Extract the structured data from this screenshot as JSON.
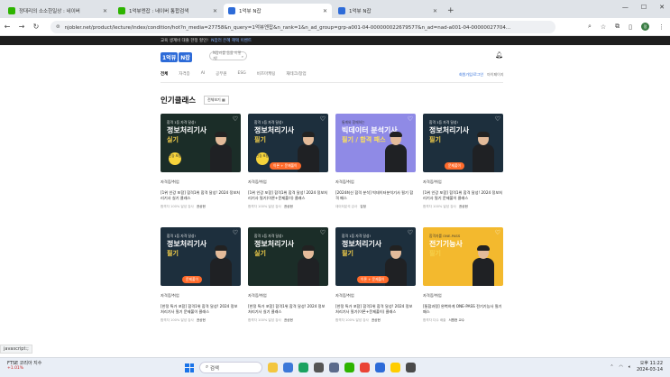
{
  "browser": {
    "tabs": [
      {
        "label": "정대리의 소소한일상 : 네이버",
        "color": "#2db400",
        "active": false
      },
      {
        "label": "1억뷰엔잡 : 네이버 통합검색",
        "color": "#2db400",
        "active": false
      },
      {
        "label": "1억뷰 N잡",
        "color": "#2d6bd8",
        "active": true
      },
      {
        "label": "1억뷰 N잡",
        "color": "#2d6bd8",
        "active": false
      }
    ],
    "tab_close": "✕",
    "new_tab": "+",
    "url": "njobler.net/product/lecture/index/condition/hot?n_media=27758&n_query=1억뷰엔잡&n_rank=1&n_ad_group=grp-a001-04-000000022679577&n_ad=nad-a001-04-00000027704...",
    "profile_initial": "정"
  },
  "topbanner": {
    "text": "교육 생계비 대출 한정 할인!",
    "link": "N잡러 은혜 혜택 이벤트"
  },
  "site": {
    "logo": [
      "1억뷰",
      "N잡"
    ],
    "search_placeholder": "N잡러를 돕을 이렇게!",
    "nav": [
      "전체",
      "자격증",
      "AI",
      "공무원",
      "ESG",
      "비즈마케팅",
      "재테크/창업"
    ],
    "nav_active": "전체",
    "right_links": {
      "blue": "회원가입/로그인",
      "gray": "마이페이지"
    },
    "section_title": "인기클래스",
    "section_all": "전체보기"
  },
  "cards": [
    {
      "t1": "합격 1등 자격 달성!",
      "t2": "정보처리기사",
      "t3": "실기",
      "bg": "#1b2d28",
      "pill": "",
      "badge": "인강\n포함",
      "meta": "자격증/취업",
      "title": "[1위 인강 포함] 합격1위 합격 달성! 2024 정보처리기사 실기 클래스",
      "inst": "합격자 100% 달성 강사",
      "name": "권상현"
    },
    {
      "t1": "합격 1등 자격 달성!",
      "t2": "정보처리기사",
      "t3": "필기",
      "bg": "#1d2f3d",
      "pill": "이론 + 문제풀이",
      "badge": "인강\n포함",
      "meta": "자격증/취업",
      "title": "[1위 인강 포함] 합격1위 합격 달성! 2024 정보처리기사 필기(이론+문제풀이) 클래스",
      "inst": "합격자 100% 달성 강사",
      "name": "권상현"
    },
    {
      "t1": "통계와 함께하는",
      "t2": "빅데이터 분석기사",
      "t3": "필기 / 합격 패스",
      "bg": "#8f8ae6",
      "pill": "",
      "badge": "",
      "meta": "자격증/취업",
      "title": "[2024최신 합격 분석] 빅데이터분석기사 필기 합격 패스",
      "inst": "데이터분석 강사",
      "name": "김정"
    },
    {
      "t1": "합격 1등 자격 달성!",
      "t2": "정보처리기사",
      "t3": "필기",
      "bg": "#1d2f3d",
      "pill": "문제풀이",
      "badge": "",
      "meta": "자격증/취업",
      "title": "[1위 인강 포함] 합격1위 합격 달성! 2024 정보처리기사 필기 문제풀이 클래스",
      "inst": "합격자 100% 달성 강사",
      "name": "권상현"
    },
    {
      "t1": "합격 1등 자격 달성!",
      "t2": "정보처리기사",
      "t3": "필기",
      "bg": "#1d2f3d",
      "pill": "문제풀이",
      "badge": "",
      "meta": "자격증/취업",
      "title": "[한정 특가 포함] 합격1위 합격 달성! 2024 정보처리기사 필기 문제풀이 클래스",
      "inst": "합격자 100% 달성 강사",
      "name": "권상현"
    },
    {
      "t1": "합격 1등 자격 달성!",
      "t2": "정보처리기사",
      "t3": "실기",
      "bg": "#1b2d28",
      "pill": "",
      "badge": "",
      "meta": "자격증/취업",
      "title": "[한정 특가 포함] 합격1위 합격 달성! 2024 정보처리기사 실기 클래스",
      "inst": "합격자 100% 달성 강사",
      "name": "권상현"
    },
    {
      "t1": "합격 1등 자격 달성!",
      "t2": "정보처리기사",
      "t3": "필기",
      "bg": "#1d2f3d",
      "pill": "이론 + 문제풀이",
      "badge": "",
      "meta": "자격증/취업",
      "title": "[한정 특가 포함] 합격1위 합격 달성! 2024 정보처리기사 필기(이론+문제풀이) 클래스",
      "inst": "합격자 100% 달성 강사",
      "name": "권상현"
    },
    {
      "t1": "합격자를 ONE-PASS",
      "t2": "전기기능사",
      "t3": "필기",
      "bg": "#f3b92e",
      "pill": "",
      "badge": "",
      "meta": "자격증/취업",
      "title": "[통합과정] 완벽하게 ONE-PASS 전기기능사 필기 패스",
      "inst": "합격자 다수 배출",
      "name": "서원현 교수"
    }
  ],
  "peeks": [
    "#3d6b3c",
    "#2b2b2b",
    "#e8dcc6",
    "#f0e2d0"
  ],
  "status_text": "javascript:;",
  "taskbar": {
    "stock_name": "FTSE 코리아 지수",
    "stock_change": "+1.01%",
    "search_label": "검색",
    "apps": [
      "#f3c63f",
      "#3c78d8",
      "#1aa260",
      "#555",
      "#5b6b8c",
      "#2db400",
      "#ea4335",
      "#2d6bd8",
      "#ffcd00",
      "#4a4a4a"
    ],
    "time": "오후 11:22",
    "date": "2024-03-14"
  }
}
